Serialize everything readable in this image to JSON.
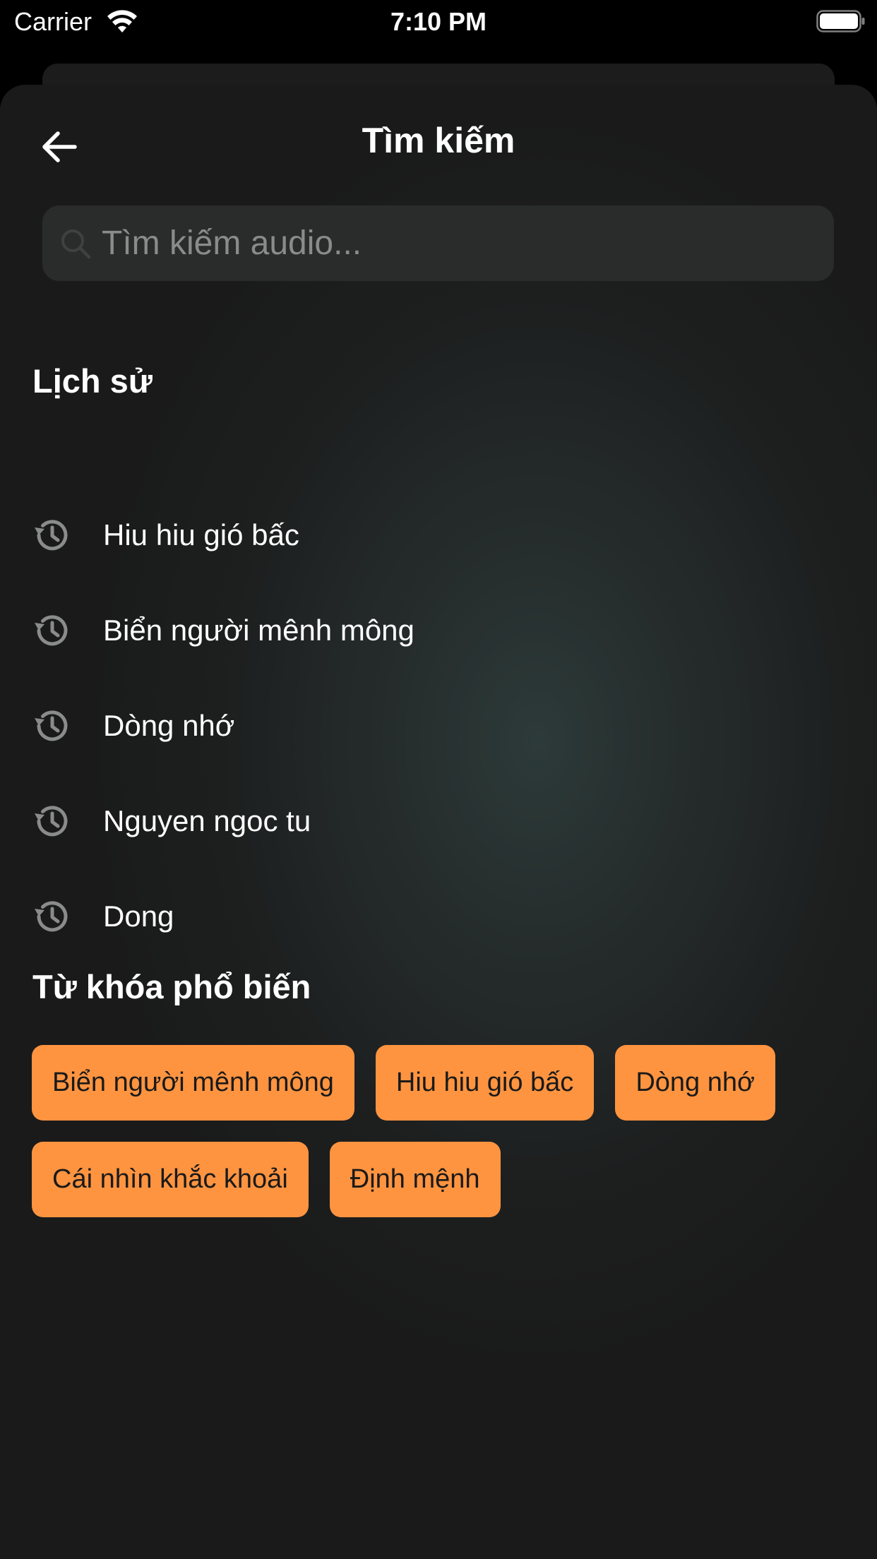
{
  "status_bar": {
    "carrier": "Carrier",
    "time": "7:10 PM"
  },
  "header": {
    "title": "Tìm kiếm",
    "back_icon": "arrow-left-icon"
  },
  "search": {
    "placeholder": "Tìm kiếm audio...",
    "value": ""
  },
  "history": {
    "title": "Lịch sử",
    "items": [
      {
        "label": "Hiu hiu gió bấc"
      },
      {
        "label": "Biển người mênh mông"
      },
      {
        "label": "Dòng nhớ"
      },
      {
        "label": "Nguyen ngoc tu"
      },
      {
        "label": "Dong"
      }
    ]
  },
  "popular": {
    "title": "Từ khóa phổ biến",
    "keywords": [
      {
        "label": "Biển người mênh mông"
      },
      {
        "label": "Hiu hiu gió bấc"
      },
      {
        "label": "Dòng nhớ"
      },
      {
        "label": "Cái nhìn khắc khoải"
      },
      {
        "label": "Định mệnh"
      }
    ]
  },
  "colors": {
    "accent": "#ff9440",
    "background": "#1a1a1a",
    "search_bg": "#2a2b2b"
  }
}
